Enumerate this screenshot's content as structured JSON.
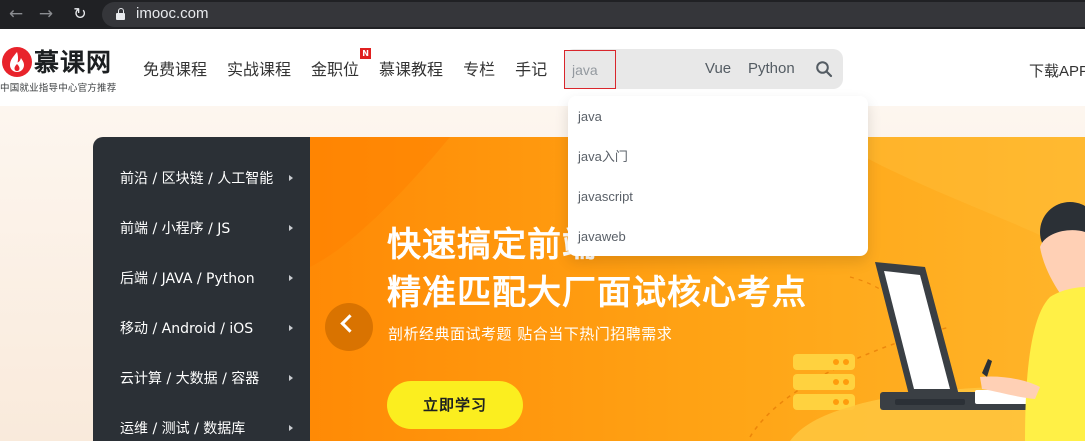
{
  "browser": {
    "url": "imooc.com"
  },
  "header": {
    "logo_text": "慕课网",
    "logo_sub": "中国就业指导中心官方推荐",
    "nav": [
      {
        "label": "免费课程"
      },
      {
        "label": "实战课程"
      },
      {
        "label": "金职位",
        "badge": "N"
      },
      {
        "label": "慕课教程"
      },
      {
        "label": "专栏"
      },
      {
        "label": "手记"
      }
    ],
    "search": {
      "value": "java",
      "tags": [
        "Vue",
        "Python"
      ]
    },
    "download_label": "下载APP"
  },
  "side_menu": {
    "items": [
      {
        "label": "前沿 / 区块链 / 人工智能"
      },
      {
        "label": "前端 / 小程序 / JS"
      },
      {
        "label": "后端 / JAVA / Python"
      },
      {
        "label": "移动 / Android / iOS"
      },
      {
        "label": "云计算 / 大数据 / 容器"
      },
      {
        "label": "运维 / 测试 / 数据库"
      }
    ]
  },
  "banner": {
    "headline_line1": "快速搞定前端",
    "headline_line2": "精准匹配大厂面试核心考点",
    "subline": "剖析经典面试考题  贴合当下热门招聘需求",
    "cta_label": "立即学习"
  },
  "suggestions": [
    "java",
    "java入门",
    "javascript",
    "javaweb"
  ],
  "colors": {
    "brand_red": "#e8232b",
    "banner_orange": "#ff9c0d",
    "cta_yellow": "#fbee1f",
    "side_menu_bg": "#2b3036"
  }
}
